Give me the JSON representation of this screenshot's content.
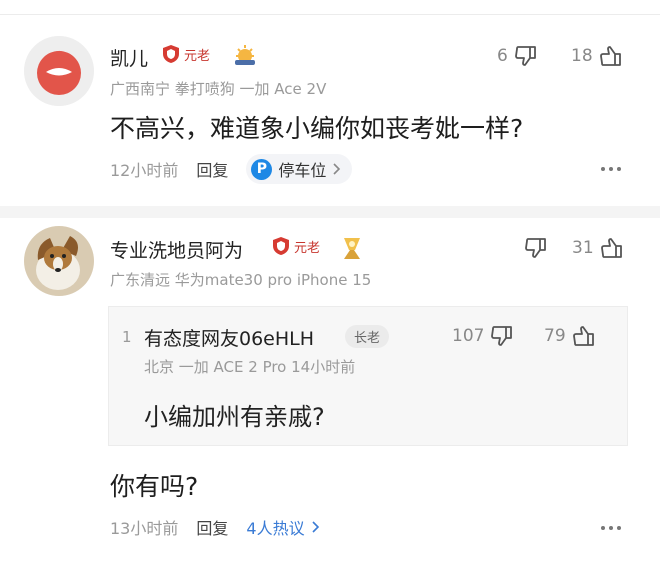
{
  "comments": [
    {
      "username": "凯儿",
      "badge": "元老",
      "meta": "广西南宁  拳打喷狗  一加 Ace 2V",
      "text": "不高兴，难道象小编你如丧考妣一样?",
      "dislikes": "6",
      "likes": "18",
      "time": "12小时前",
      "reply_label": "回复",
      "chip_label": "停车位",
      "chip_icon_letter": "P"
    },
    {
      "username": "专业洗地员阿为",
      "badge": "元老",
      "meta": "广东清远  华为mate30 pro  iPhone 15",
      "dislikes": "",
      "likes": "31",
      "quote": {
        "index": "1",
        "username": "有态度网友06eHLH",
        "rank": "长老",
        "meta": "北京  一加 ACE 2 Pro  14小时前",
        "text": "小编加州有亲戚?",
        "dislikes": "107",
        "likes": "79"
      },
      "text": "你有吗?",
      "time": "13小时前",
      "reply_label": "回复",
      "hot_label": "4人热议"
    }
  ],
  "colors": {
    "badge_red": "#c7362e",
    "link_blue": "#3a7bd5",
    "chip_blue": "#1e88e5"
  }
}
